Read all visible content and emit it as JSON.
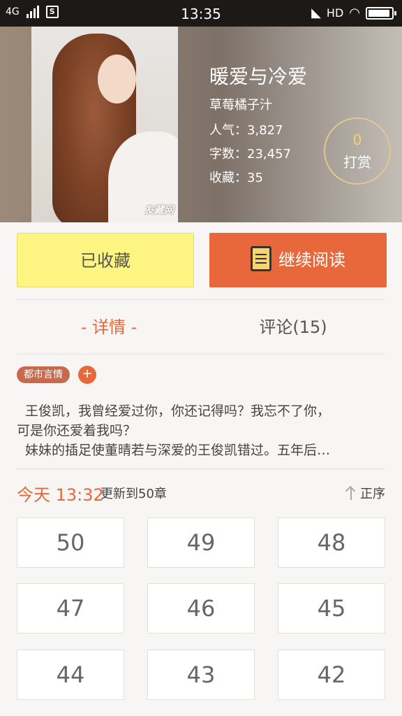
{
  "status_bar": {
    "network": "4G",
    "time": "13:35",
    "hd": "HD"
  },
  "book": {
    "title": "暖爱与冷爱",
    "author": "草莓橘子汁",
    "popularity": "人气：3,827",
    "word_count": "字数：23,457",
    "favorites": "收藏：35",
    "cover_logo": "友藏网"
  },
  "tip": {
    "count": "0",
    "label": "打赏"
  },
  "actions": {
    "favorite_label": "已收藏",
    "read_label": "继续阅读"
  },
  "tabs": {
    "detail": "- 详情 -",
    "comments": "评论(15)"
  },
  "tag": {
    "label": "都市言情",
    "add": "+"
  },
  "description": {
    "line1": "王俊凯，我曾经爱过你，你还记得吗？我忘不了你，",
    "line2": "可是你还爱着我吗？",
    "line3": "妹妹的插足使董晴若与深爱的王俊凯错过。五年后…"
  },
  "update": {
    "time": "今天 13:32",
    "note": "更新到50章",
    "sort_label": "正序"
  },
  "chapters": [
    "50",
    "49",
    "48",
    "47",
    "46",
    "45",
    "44",
    "43",
    "42"
  ],
  "colors": {
    "accent": "#e9683b",
    "favorite_bg": "#fef482",
    "tag_bg": "#c8694c"
  }
}
